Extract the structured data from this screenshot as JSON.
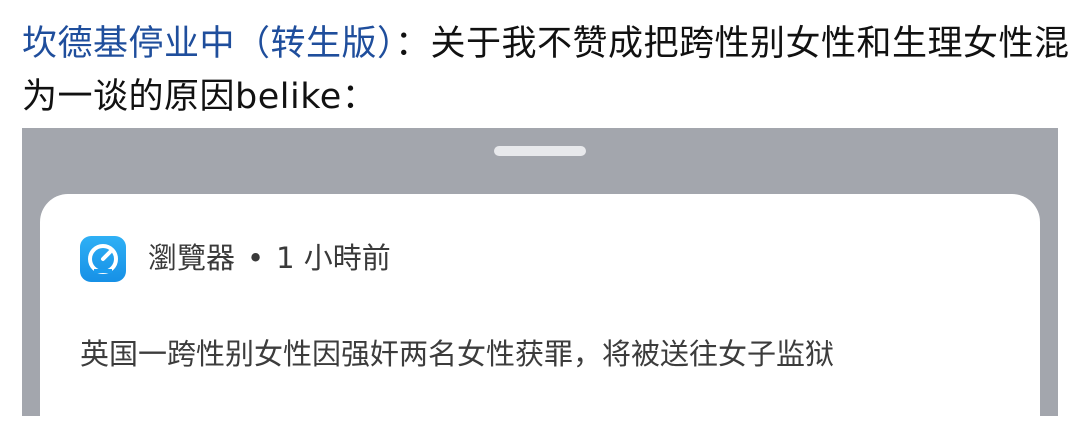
{
  "post": {
    "author": "坎德基停业中（转生版）",
    "colon": "：",
    "text": "关于我不赞成把跨性别女性和生理女性混为一谈的原因belike："
  },
  "notification": {
    "app_name": "瀏覽器",
    "separator": "•",
    "time": "1 小時前",
    "message": "英国一跨性别女性因强奸两名女性获罪，将被送往女子监狱",
    "app_icon": "browser-compass-icon"
  },
  "colors": {
    "author": "#1f4e9c",
    "shade_background": "#a3a6ad",
    "app_icon": "#1a9cef"
  }
}
